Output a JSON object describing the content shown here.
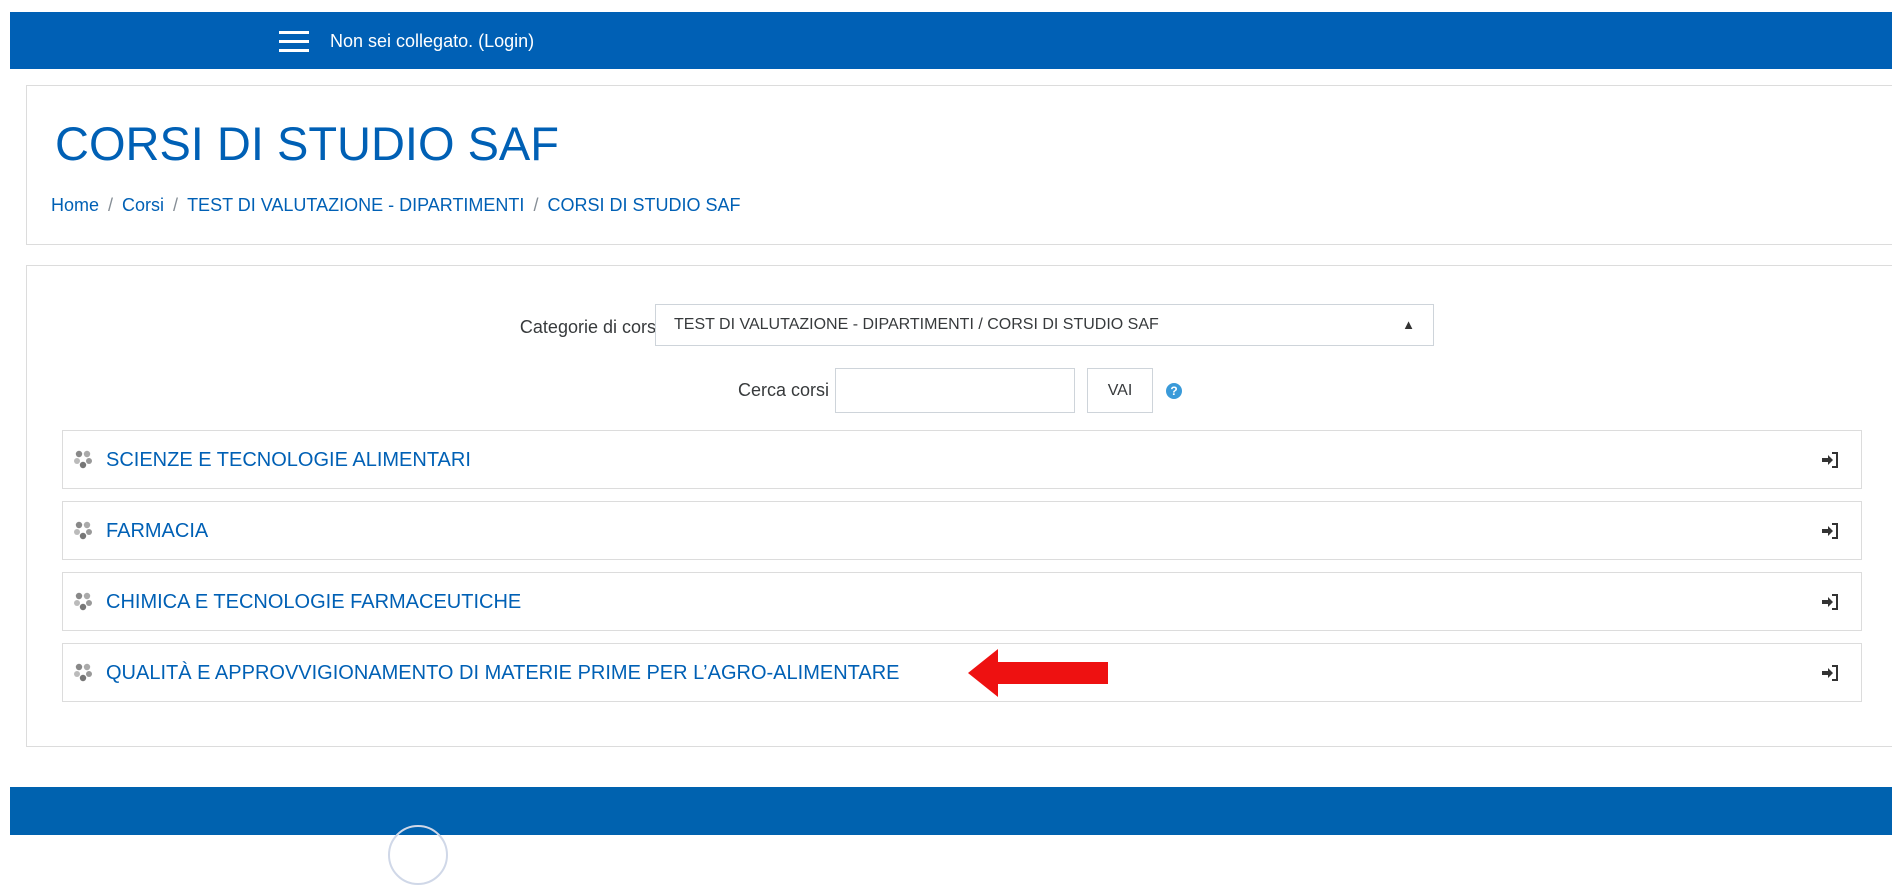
{
  "navbar": {
    "login_text": "Non sei collegato. (Login)"
  },
  "header": {
    "title": "CORSI DI STUDIO SAF",
    "breadcrumb": [
      "Home",
      "Corsi",
      "TEST DI VALUTAZIONE - DIPARTIMENTI",
      "CORSI DI STUDIO SAF"
    ]
  },
  "filters": {
    "category_label": "Categorie di corso:",
    "category_selected": "TEST DI VALUTAZIONE - DIPARTIMENTI / CORSI DI STUDIO SAF",
    "search_label": "Cerca corsi",
    "search_value": "",
    "go_label": "VAI"
  },
  "categories": [
    {
      "name": "SCIENZE E TECNOLOGIE ALIMENTARI"
    },
    {
      "name": "FARMACIA"
    },
    {
      "name": "CHIMICA E TECNOLOGIE FARMACEUTICHE"
    },
    {
      "name": "QUALITÀ E APPROVVIGIONAMENTO DI MATERIE PRIME PER L’AGRO-ALIMENTARE"
    }
  ],
  "colors": {
    "brand": "#0060b5",
    "annotation_arrow": "#ee1111"
  },
  "icons": {
    "menu": "hamburger-icon",
    "help": "help-icon",
    "category": "category-icon",
    "enter": "enter-icon"
  }
}
